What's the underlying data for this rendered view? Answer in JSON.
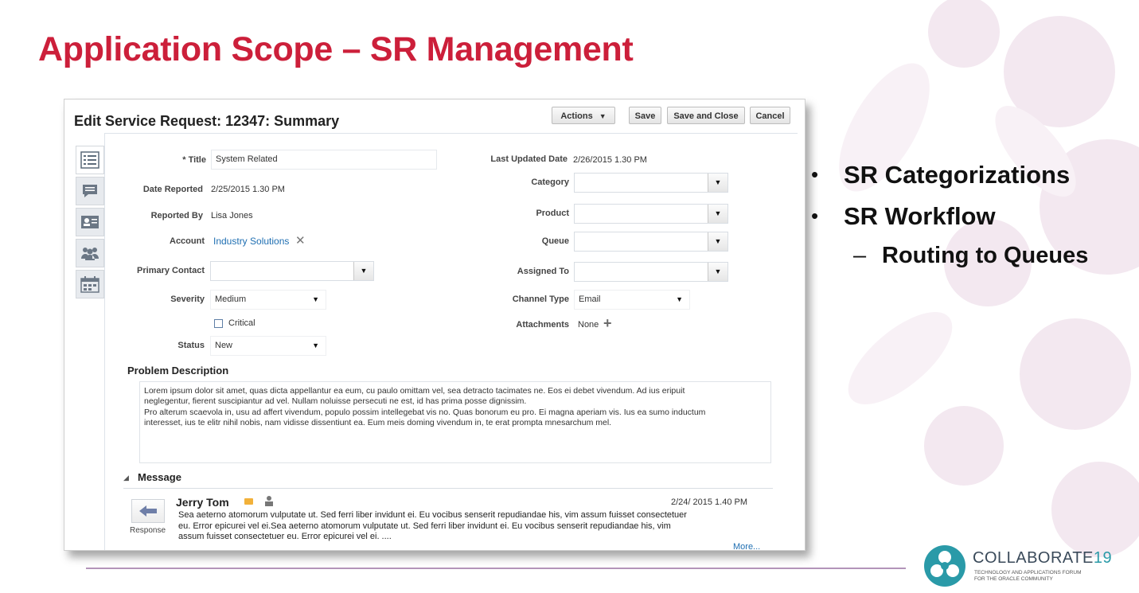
{
  "slide": {
    "title": "Application Scope – SR Management",
    "bullets": [
      {
        "text": "SR Categorizations",
        "level": 1
      },
      {
        "text": "SR Workflow",
        "level": 1
      },
      {
        "text": "Routing to Queues",
        "level": 2
      }
    ],
    "bullet_marker": "•",
    "sub_marker": "–",
    "logo": {
      "name": "COLLABORATE",
      "year": "19",
      "tagline_line1": "TECHNOLOGY AND APPLICATIONS FORUM",
      "tagline_line2": "FOR THE ORACLE COMMUNITY"
    },
    "colors": {
      "title": "#cc1f3a",
      "rule": "#b394b9",
      "logo_teal": "#2a9aa8"
    }
  },
  "screen": {
    "header_title": "Edit Service Request: 12347: Summary",
    "toolbar": {
      "actions_label": "Actions",
      "save_label": "Save",
      "save_close_label": "Save and Close",
      "cancel_label": "Cancel"
    },
    "side_tabs": [
      "summary-icon",
      "messages-icon",
      "contact-card-icon",
      "team-icon",
      "calendar-icon"
    ],
    "form": {
      "title_label": "* Title",
      "title_value": "System Related",
      "date_reported_label": "Date Reported",
      "date_reported_value": "2/25/2015 1.30 PM",
      "reported_by_label": "Reported By",
      "reported_by_value": "Lisa Jones",
      "account_label": "Account",
      "account_value": "Industry Solutions",
      "primary_contact_label": "Primary Contact",
      "primary_contact_value": "",
      "severity_label": "Severity",
      "severity_value": "Medium",
      "critical_label": "Critical",
      "status_label": "Status",
      "status_value": "New",
      "last_updated_label": "Last Updated Date",
      "last_updated_value": "2/26/2015 1.30 PM",
      "category_label": "Category",
      "category_value": "",
      "product_label": "Product",
      "product_value": "",
      "queue_label": "Queue",
      "queue_value": "",
      "assigned_to_label": "Assigned To",
      "assigned_to_value": "",
      "channel_type_label": "Channel Type",
      "channel_type_value": "Email",
      "attachments_label": "Attachments",
      "attachments_value": "None"
    },
    "problem": {
      "heading": "Problem Description",
      "lines": [
        "Lorem ipsum dolor sit amet, quas dicta appellantur ea eum, cu paulo omittam vel, sea detracto tacimates ne. Eos ei debet vivendum. Ad ius eripuit",
        "neglegentur, fierent suscipiantur ad vel. Nullam noluisse persecuti ne est, id has prima posse dignissim.",
        "Pro alterum scaevola in, usu ad affert vivendum, populo possim intellegebat vis no. Quas bonorum eu pro. Ei magna aperiam vis. Ius ea sumo inductum",
        "interesset, ius te elitr nihil nobis, nam vidisse dissentiunt ea. Eum meis doming vivendum in, te erat prompta mnesarchum mel."
      ]
    },
    "message": {
      "heading": "Message",
      "author": "Jerry Tom",
      "timestamp": "2/24/ 2015 1.40 PM",
      "response_label": "Response",
      "body_lines": [
        "Sea aeterno atomorum vulputate ut. Sed ferri liber invidunt ei. Eu vocibus senserit repudiandae his, vim assum fuisset consectetuer",
        "eu. Error epicurei vel ei.Sea aeterno atomorum vulputate ut. Sed ferri liber invidunt ei. Eu vocibus senserit repudiandae his, vim",
        "assum fuisset consectetuer eu. Error epicurei vel ei. ...."
      ],
      "more_label": "More..."
    }
  }
}
